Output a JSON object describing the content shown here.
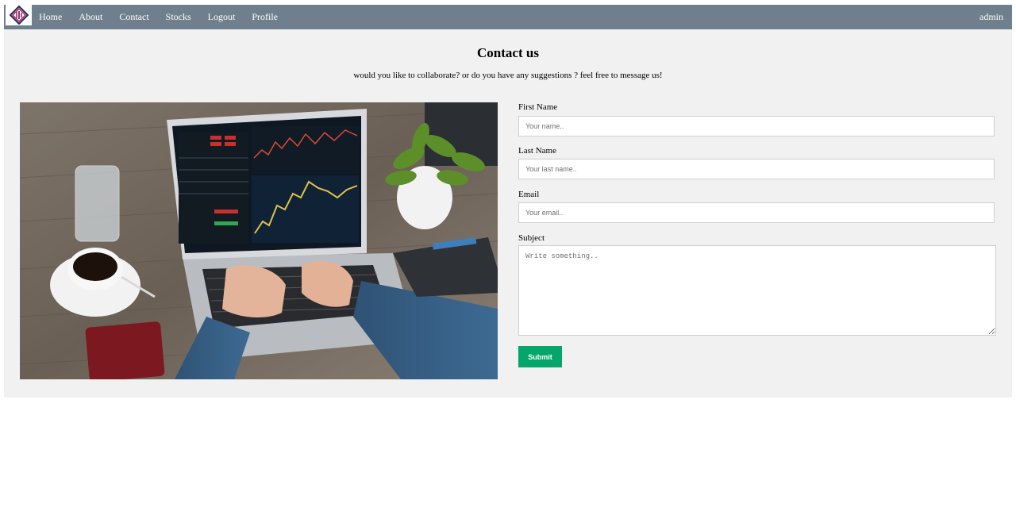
{
  "navbar": {
    "logo_icon": "brand-diamond-logo-icon",
    "links": [
      "Home",
      "About",
      "Contact",
      "Stocks",
      "Logout",
      "Profile"
    ],
    "user": "admin",
    "background": "#707f8d"
  },
  "page": {
    "title": "Contact us",
    "subtitle": "would you like to collaborate? or do you have any suggestions ? feel free to message us!"
  },
  "hero_image": {
    "icon": "trading-laptop-photo"
  },
  "form": {
    "first_name": {
      "label": "First Name",
      "placeholder": "Your name.."
    },
    "last_name": {
      "label": "Last Name",
      "placeholder": "Your last name.."
    },
    "email": {
      "label": "Email",
      "placeholder": "Your email.."
    },
    "subject": {
      "label": "Subject",
      "placeholder": "Write something.."
    },
    "submit_label": "Submit",
    "submit_color": "#05a66b"
  }
}
